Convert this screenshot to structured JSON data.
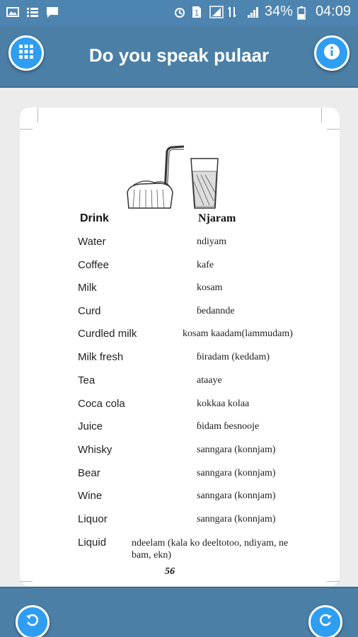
{
  "status_bar": {
    "battery_percent": "34%",
    "time": "04:09",
    "icons": [
      "image-icon",
      "list-icon",
      "message-icon",
      "alarm-icon",
      "sim-1-icon",
      "sim-signal-icon",
      "data-arrows-icon",
      "signal-icon",
      "battery-icon"
    ]
  },
  "app_bar": {
    "title": "Do you speak pulaar",
    "left_icon": "grid-menu-icon",
    "right_icon": "info-icon",
    "accent": "#2e9ef3",
    "bar_color": "#4b7fa6"
  },
  "page": {
    "headers": {
      "english": "Drink",
      "pulaar": "Njaram"
    },
    "rows": [
      {
        "english": "Water",
        "pulaar": "ndiyam"
      },
      {
        "english": "Coffee",
        "pulaar": "kafe"
      },
      {
        "english": "Milk",
        "pulaar": "kosam"
      },
      {
        "english": "Curd",
        "pulaar": "ɓedannde"
      },
      {
        "english": "Curdled milk",
        "pulaar": "kosam kaadam(lammudam)"
      },
      {
        "english": "Milk fresh",
        "pulaar": "ɓiradam (keddam)"
      },
      {
        "english": "Tea",
        "pulaar": "ataaye"
      },
      {
        "english": "Coca cola",
        "pulaar": "kokkaa kolaa"
      },
      {
        "english": "Juice",
        "pulaar": "ɓidam ɓesnooje"
      },
      {
        "english": "Whisky",
        "pulaar": "sanngara (konnjam)"
      },
      {
        "english": "Bear",
        "pulaar": "sanngara (konnjam)"
      },
      {
        "english": "Wine",
        "pulaar": "sanngara (konnjam)"
      },
      {
        "english": "Liquor",
        "pulaar": "sanngara (konnjam)"
      },
      {
        "english": "Liquid",
        "pulaar": "ndeelam (kala ko deeltotoo, ndiyam, ne bam, ekn)"
      }
    ],
    "page_number": "56",
    "illustration_icon": "drinks-illustration-icon"
  },
  "bottom_bar": {
    "back_icon": "undo-arrow-icon",
    "forward_icon": "redo-arrow-icon"
  }
}
